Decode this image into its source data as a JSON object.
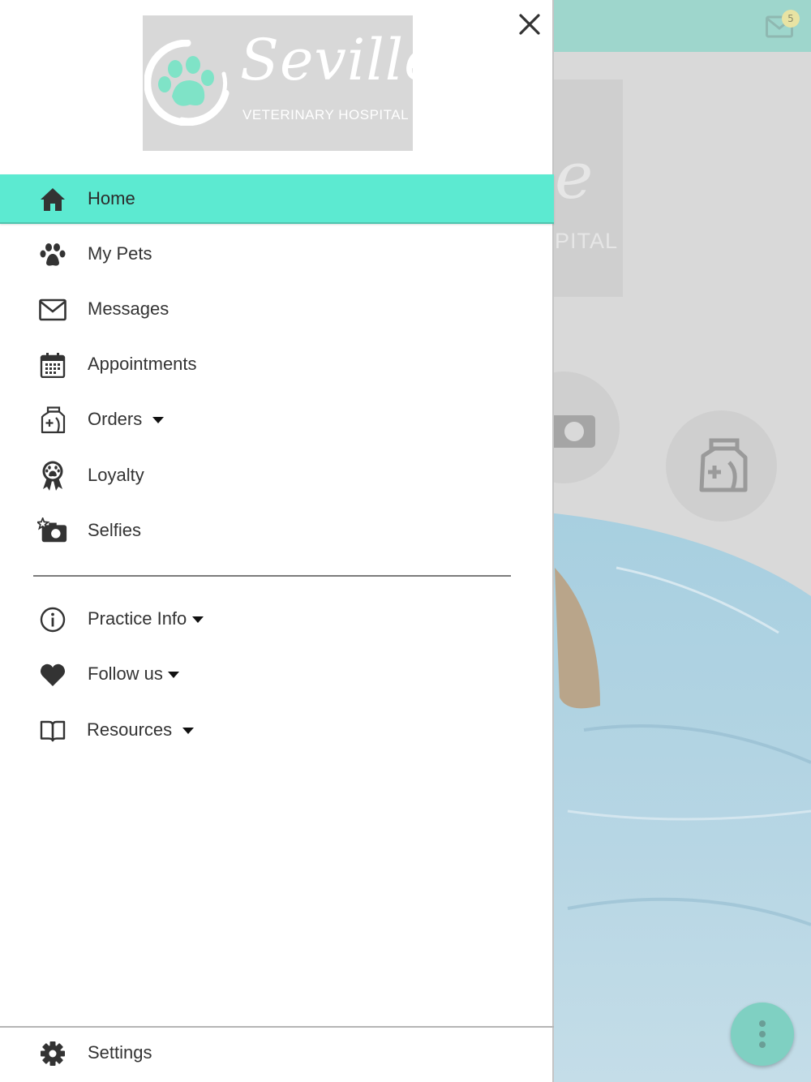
{
  "brand": {
    "name": "Seville",
    "subtitle": "VETERINARY HOSPITAL",
    "accent_color": "#5cead1",
    "logo_paw_color": "#7fe3c7"
  },
  "background": {
    "header_color": "#9ed6cc",
    "mail_badge_count": "5",
    "logo_text_fragment": "PITAL",
    "logo_script_fragment": "e"
  },
  "drawer": {
    "close_icon": "close-icon",
    "nav": [
      {
        "label": "Home",
        "icon": "home-icon",
        "active": true
      },
      {
        "label": "My Pets",
        "icon": "paw-icon"
      },
      {
        "label": "Messages",
        "icon": "envelope-icon"
      },
      {
        "label": "Appointments",
        "icon": "calendar-icon"
      },
      {
        "label": "Orders",
        "icon": "medicine-bag-icon",
        "has_dropdown": true
      },
      {
        "label": "Loyalty",
        "icon": "award-ribbon-icon"
      },
      {
        "label": "Selfies",
        "icon": "camera-star-icon"
      }
    ],
    "secondary": [
      {
        "label": "Practice Info",
        "icon": "info-icon",
        "has_dropdown": true
      },
      {
        "label": "Follow us",
        "icon": "heart-icon",
        "has_dropdown": true
      },
      {
        "label": "Resources",
        "icon": "book-icon",
        "has_dropdown": true
      }
    ],
    "footer": {
      "label": "Settings",
      "icon": "gear-icon"
    }
  }
}
